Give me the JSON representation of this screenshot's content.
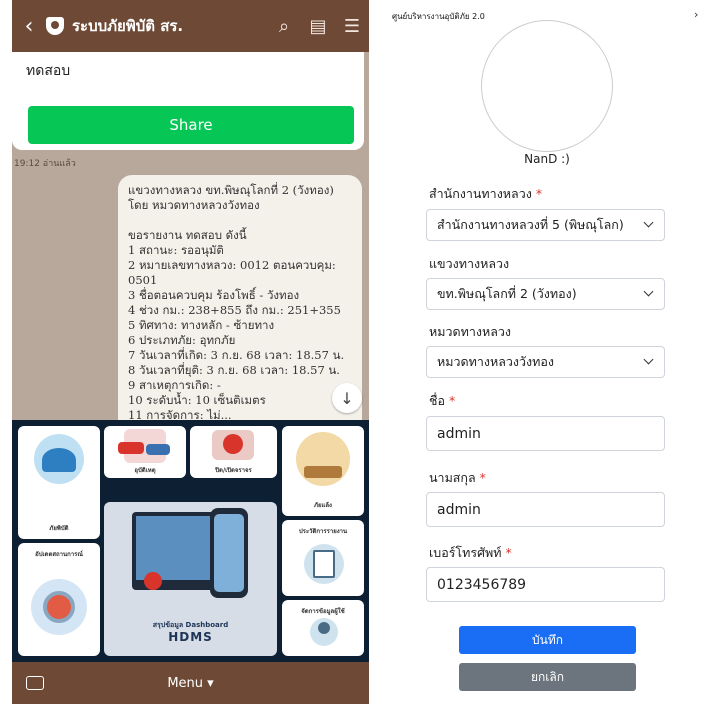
{
  "chat": {
    "title": "ระบบภัยพิบัติ สร.",
    "top_message": "ทดสอบ",
    "share_label": "Share",
    "timestamp": "19:12 อ่านแล้ว",
    "report_lines": [
      "แขวงทางหลวง ขท.พิษณุโลกที่ 2 (วังทอง)",
      "โดย หมวดทางหลวงวังทอง",
      "",
      "ขอรายงาน ทดสอบ ดังนี้",
      "1 สถานะ: รออนุมัติ",
      "2 หมายเลขทางหลวง: 0012 ตอนควบคุม:",
      "0501",
      "3 ชื่อตอนควบคุม ร้องโพธิ์ - วังทอง",
      "4 ช่วง กม.: 238+855 ถึง กม.: 251+355",
      "5 ทิศทาง: ทางหลัก - ซ้ายทาง",
      "6 ประเภทภัย: อุทกภัย",
      "7 วันเวลาที่เกิด: 3 ก.ย. 68 เวลา: 18.57 น.",
      "8 วันเวลาที่ยุติ: 3 ก.ย. 68 เวลา: 18.57 น.",
      "9 สาเหตุการเกิด: -",
      "10 ระดับน้ำ: 10 เซ็นติเมตร",
      "11 การจัดการ: ไม่..."
    ],
    "tiles": {
      "disaster": "ภัยพิบัติ",
      "accident": "อุบัติเหตุ",
      "road_closure": "ปิด/เปิดจราจร",
      "drought": "ภัยแล้ง",
      "situation": "อัปเดตสถานการณ์",
      "report_history": "ประวัติการรายงาน",
      "dashboard_caption": "สรุปข้อมูล Dashboard",
      "hdms": "HDMS",
      "user_mgmt": "จัดการข้อมูลผู้ใช้"
    },
    "menu_label": "Menu ▾"
  },
  "form": {
    "app_name": "ศูนย์บริหารงานอุบัติภัย 2.0",
    "user_display": "NanD :)",
    "fields": [
      {
        "label": "สำนักงานทางหลวง",
        "required": "*",
        "value": "สำนักงานทางหลวงที่ 5 (พิษณุโลก)",
        "type": "select"
      },
      {
        "label": "แขวงทางหลวง",
        "required": "",
        "value": "ขท.พิษณุโลกที่ 2 (วังทอง)",
        "type": "select"
      },
      {
        "label": "หมวดทางหลวง",
        "required": "",
        "value": "หมวดทางหลวงวังทอง",
        "type": "select"
      },
      {
        "label": "ชื่อ",
        "required": "*",
        "value": "admin",
        "type": "text"
      },
      {
        "label": "นามสกุล",
        "required": "*",
        "value": "admin",
        "type": "text"
      },
      {
        "label": "เบอร์โทรศัพท์",
        "required": "*",
        "value": "0123456789",
        "type": "text"
      }
    ],
    "save_label": "บันทึก",
    "cancel_label": "ยกเลิก"
  },
  "colors": {
    "line_brown": "#6e4a36",
    "share_green": "#06c755",
    "primary": "#1a6ef5",
    "secondary": "#6c757d",
    "required": "#d9342b",
    "menu_bg": "#0c1f33"
  }
}
